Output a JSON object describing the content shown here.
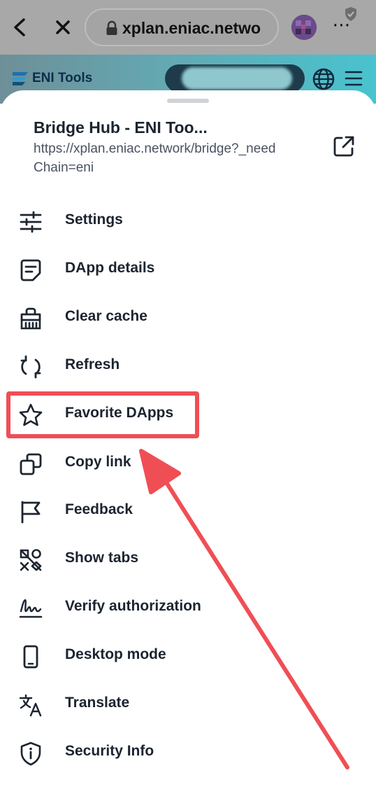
{
  "browser": {
    "url_display": "xplan.eniac.netwo",
    "more_label": "⋯"
  },
  "page": {
    "brand": "ENI Tools"
  },
  "sheet": {
    "title": "Bridge Hub - ENI Too...",
    "url": "https://xplan.eniac.network/bridge?_needChain=eni"
  },
  "menu": {
    "items": [
      {
        "label": "Settings",
        "icon": "sliders-icon"
      },
      {
        "label": "DApp details",
        "icon": "document-icon"
      },
      {
        "label": "Clear cache",
        "icon": "broom-icon"
      },
      {
        "label": "Refresh",
        "icon": "refresh-icon"
      },
      {
        "label": "Favorite DApps",
        "icon": "star-icon"
      },
      {
        "label": "Copy link",
        "icon": "copy-icon"
      },
      {
        "label": "Feedback",
        "icon": "flag-icon"
      },
      {
        "label": "Show tabs",
        "icon": "tabs-icon"
      },
      {
        "label": "Verify authorization",
        "icon": "signature-icon"
      },
      {
        "label": "Desktop mode",
        "icon": "phone-icon"
      },
      {
        "label": "Translate",
        "icon": "translate-icon"
      },
      {
        "label": "Security Info",
        "icon": "info-shield-icon"
      }
    ]
  },
  "annotation": {
    "highlight_color": "#f04e55",
    "highlighted_item": "Favorite DApps"
  }
}
